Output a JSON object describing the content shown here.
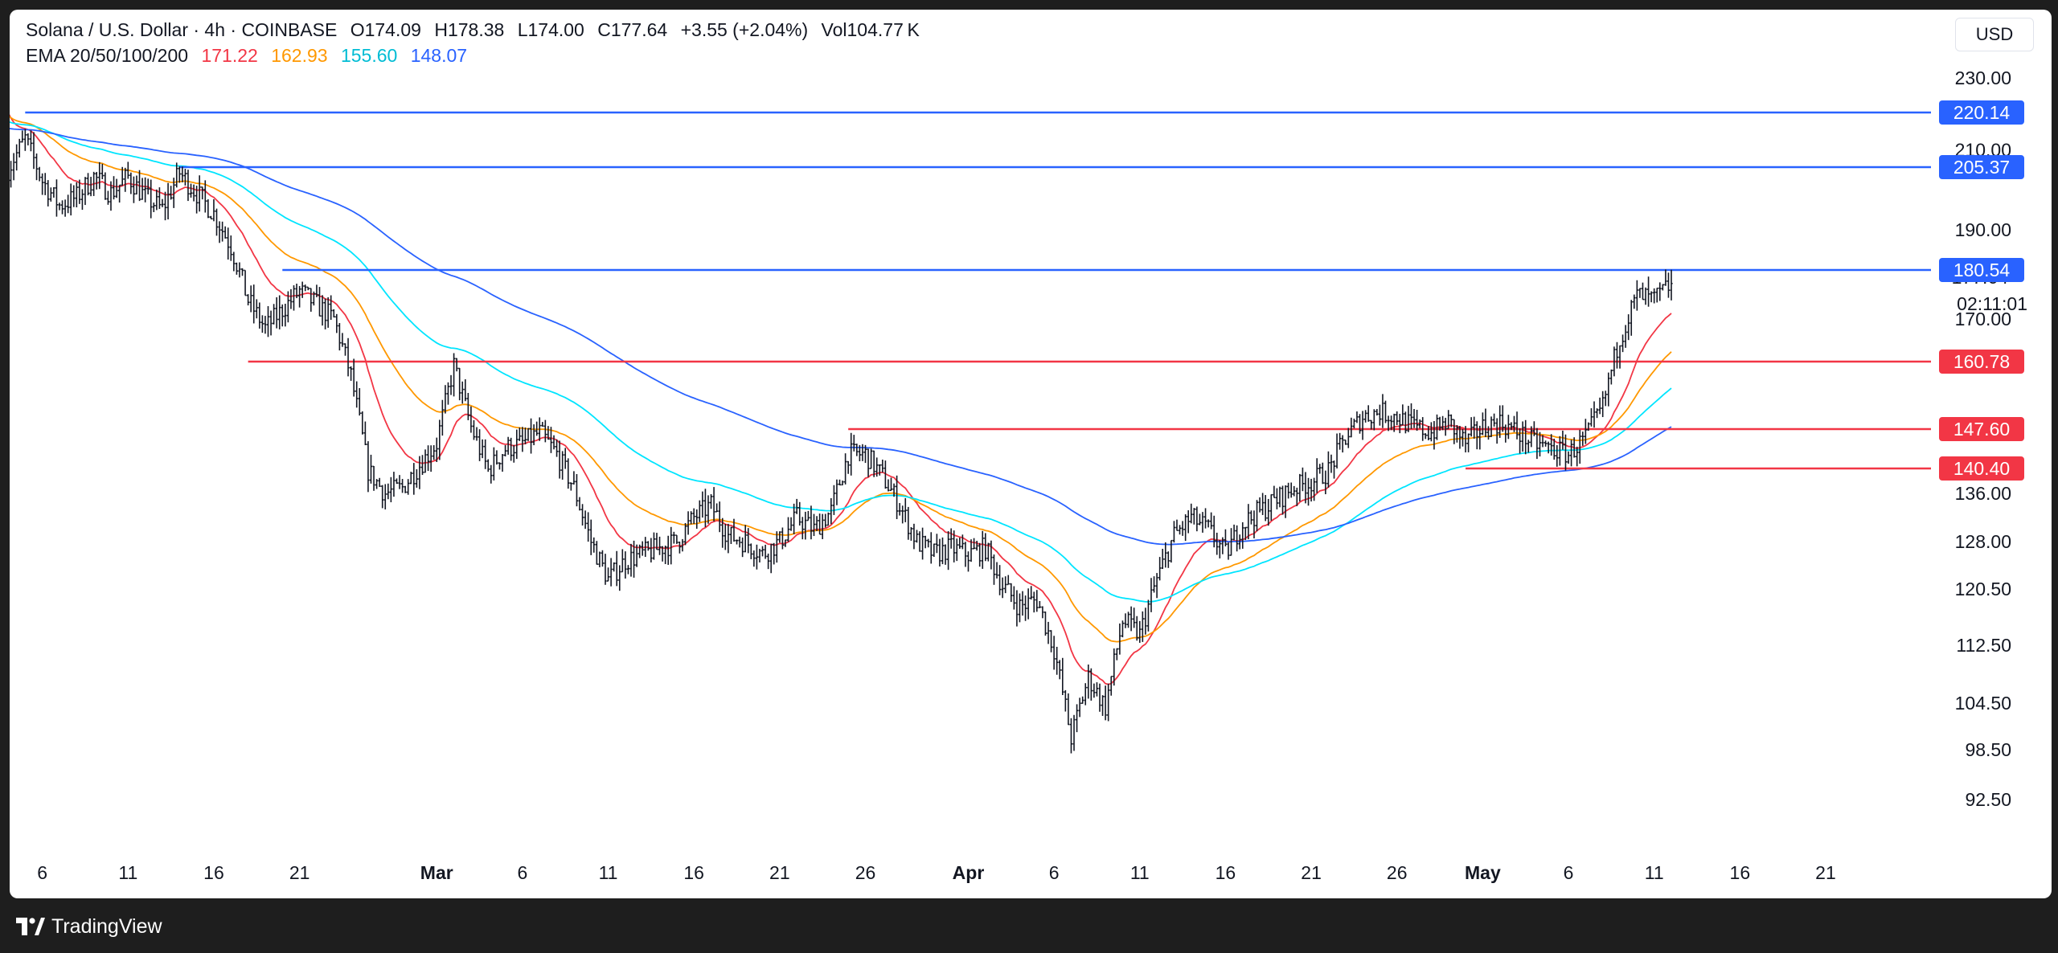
{
  "header": {
    "symbol": "Solana / U.S. Dollar · 4h · COINBASE",
    "open": "O174.09",
    "high": "H178.38",
    "low": "L174.00",
    "close": "C177.64",
    "change": "+3.55 (+2.04%)",
    "volume": "Vol104.77 K",
    "ema_label": "EMA 20/50/100/200",
    "ema_values": [
      {
        "text": "171.22",
        "color": "#f23645"
      },
      {
        "text": "162.93",
        "color": "#ff9800"
      },
      {
        "text": "155.60",
        "color": "#00e5ff"
      },
      {
        "text": "148.07",
        "color": "#2962ff"
      }
    ]
  },
  "currency": "USD",
  "countdown": "02:11:01",
  "brand": "TradingView",
  "chart_data": {
    "type": "candlestick",
    "x_start": "2025-02-04",
    "bar_hours": 4,
    "x_ticks": [
      "6",
      "11",
      "16",
      "21",
      "Mar",
      "6",
      "11",
      "16",
      "21",
      "26",
      "Apr",
      "6",
      "11",
      "16",
      "21",
      "26",
      "May",
      "6",
      "11",
      "16",
      "21"
    ],
    "x_tick_dates": [
      "2025-02-06",
      "2025-02-11",
      "2025-02-16",
      "2025-02-21",
      "2025-03-01",
      "2025-03-06",
      "2025-03-11",
      "2025-03-16",
      "2025-03-21",
      "2025-03-26",
      "2025-04-01",
      "2025-04-06",
      "2025-04-11",
      "2025-04-16",
      "2025-04-21",
      "2025-04-26",
      "2025-05-01",
      "2025-05-06",
      "2025-05-11",
      "2025-05-16",
      "2025-05-21"
    ],
    "y_ticks": [
      {
        "label": "230.00",
        "value": 230
      },
      {
        "label": "210.00",
        "value": 210
      },
      {
        "label": "190.00",
        "value": 190
      },
      {
        "label": "170.00",
        "value": 170
      },
      {
        "label": "136.00",
        "value": 136
      },
      {
        "label": "128.00",
        "value": 128
      },
      {
        "label": "120.50",
        "value": 120.5
      },
      {
        "label": "112.50",
        "value": 112.5
      },
      {
        "label": "104.50",
        "value": 104.5
      },
      {
        "label": "98.50",
        "value": 98.5
      },
      {
        "label": "92.50",
        "value": 92.5
      }
    ],
    "ylim": [
      88,
      236
    ],
    "last_price": "177.64",
    "levels": [
      {
        "label": "220.14",
        "value": 220.14,
        "color": "#2962ff",
        "from": "2025-02-05"
      },
      {
        "label": "205.37",
        "value": 205.37,
        "color": "#2962ff",
        "from": "2025-02-14"
      },
      {
        "label": "180.54",
        "value": 180.54,
        "color": "#2962ff",
        "from": "2025-02-20"
      },
      {
        "label": "160.78",
        "value": 160.78,
        "color": "#f23645",
        "from": "2025-02-18"
      },
      {
        "label": "147.60",
        "value": 147.6,
        "color": "#f23645",
        "from": "2025-03-25"
      },
      {
        "label": "140.40",
        "value": 140.4,
        "color": "#f23645",
        "from": "2025-04-30"
      }
    ],
    "ema_colors": [
      "#f23645",
      "#ff9800",
      "#00e5ff",
      "#2962ff"
    ],
    "closes": [
      {
        "d": "2025-02-04",
        "c": 205
      },
      {
        "d": "2025-02-05",
        "c": 213
      },
      {
        "d": "2025-02-06",
        "c": 202
      },
      {
        "d": "2025-02-07",
        "c": 196
      },
      {
        "d": "2025-02-08",
        "c": 198
      },
      {
        "d": "2025-02-09",
        "c": 203
      },
      {
        "d": "2025-02-10",
        "c": 199
      },
      {
        "d": "2025-02-11",
        "c": 203
      },
      {
        "d": "2025-02-12",
        "c": 198
      },
      {
        "d": "2025-02-13",
        "c": 195
      },
      {
        "d": "2025-02-14",
        "c": 204
      },
      {
        "d": "2025-02-15",
        "c": 199
      },
      {
        "d": "2025-02-16",
        "c": 194
      },
      {
        "d": "2025-02-17",
        "c": 186
      },
      {
        "d": "2025-02-18",
        "c": 174
      },
      {
        "d": "2025-02-19",
        "c": 168
      },
      {
        "d": "2025-02-20",
        "c": 172
      },
      {
        "d": "2025-02-21",
        "c": 176
      },
      {
        "d": "2025-02-22",
        "c": 173
      },
      {
        "d": "2025-02-23",
        "c": 170
      },
      {
        "d": "2025-02-24",
        "c": 158
      },
      {
        "d": "2025-02-25",
        "c": 140
      },
      {
        "d": "2025-02-26",
        "c": 136
      },
      {
        "d": "2025-02-27",
        "c": 137
      },
      {
        "d": "2025-02-28",
        "c": 141
      },
      {
        "d": "2025-03-01",
        "c": 145
      },
      {
        "d": "2025-03-02",
        "c": 160
      },
      {
        "d": "2025-03-03",
        "c": 148
      },
      {
        "d": "2025-03-04",
        "c": 140
      },
      {
        "d": "2025-03-05",
        "c": 144
      },
      {
        "d": "2025-03-06",
        "c": 145
      },
      {
        "d": "2025-03-07",
        "c": 147
      },
      {
        "d": "2025-03-08",
        "c": 143
      },
      {
        "d": "2025-03-09",
        "c": 137
      },
      {
        "d": "2025-03-10",
        "c": 128
      },
      {
        "d": "2025-03-11",
        "c": 122
      },
      {
        "d": "2025-03-12",
        "c": 125
      },
      {
        "d": "2025-03-13",
        "c": 126
      },
      {
        "d": "2025-03-14",
        "c": 127
      },
      {
        "d": "2025-03-15",
        "c": 128
      },
      {
        "d": "2025-03-16",
        "c": 132
      },
      {
        "d": "2025-03-17",
        "c": 134
      },
      {
        "d": "2025-03-18",
        "c": 129
      },
      {
        "d": "2025-03-19",
        "c": 128
      },
      {
        "d": "2025-03-20",
        "c": 126
      },
      {
        "d": "2025-03-21",
        "c": 128
      },
      {
        "d": "2025-03-22",
        "c": 132
      },
      {
        "d": "2025-03-23",
        "c": 130
      },
      {
        "d": "2025-03-24",
        "c": 133
      },
      {
        "d": "2025-03-25",
        "c": 143
      },
      {
        "d": "2025-03-26",
        "c": 143
      },
      {
        "d": "2025-03-27",
        "c": 139
      },
      {
        "d": "2025-03-28",
        "c": 134
      },
      {
        "d": "2025-03-29",
        "c": 128
      },
      {
        "d": "2025-03-30",
        "c": 126
      },
      {
        "d": "2025-03-31",
        "c": 127
      },
      {
        "d": "2025-04-01",
        "c": 126
      },
      {
        "d": "2025-04-02",
        "c": 127
      },
      {
        "d": "2025-04-03",
        "c": 121
      },
      {
        "d": "2025-04-04",
        "c": 118
      },
      {
        "d": "2025-04-05",
        "c": 119
      },
      {
        "d": "2025-04-06",
        "c": 112
      },
      {
        "d": "2025-04-07",
        "c": 100
      },
      {
        "d": "2025-04-08",
        "c": 108
      },
      {
        "d": "2025-04-09",
        "c": 104
      },
      {
        "d": "2025-04-10",
        "c": 116
      },
      {
        "d": "2025-04-11",
        "c": 114
      },
      {
        "d": "2025-04-12",
        "c": 122
      },
      {
        "d": "2025-04-13",
        "c": 129
      },
      {
        "d": "2025-04-14",
        "c": 132
      },
      {
        "d": "2025-04-15",
        "c": 130
      },
      {
        "d": "2025-04-16",
        "c": 126
      },
      {
        "d": "2025-04-17",
        "c": 131
      },
      {
        "d": "2025-04-18",
        "c": 133
      },
      {
        "d": "2025-04-19",
        "c": 135
      },
      {
        "d": "2025-04-20",
        "c": 137
      },
      {
        "d": "2025-04-21",
        "c": 138
      },
      {
        "d": "2025-04-22",
        "c": 140
      },
      {
        "d": "2025-04-23",
        "c": 146
      },
      {
        "d": "2025-04-24",
        "c": 150
      },
      {
        "d": "2025-04-25",
        "c": 151
      },
      {
        "d": "2025-04-26",
        "c": 150
      },
      {
        "d": "2025-04-27",
        "c": 148
      },
      {
        "d": "2025-04-28",
        "c": 147
      },
      {
        "d": "2025-04-29",
        "c": 149
      },
      {
        "d": "2025-04-30",
        "c": 145
      },
      {
        "d": "2025-05-01",
        "c": 148
      },
      {
        "d": "2025-05-02",
        "c": 149
      },
      {
        "d": "2025-05-03",
        "c": 147
      },
      {
        "d": "2025-05-04",
        "c": 145
      },
      {
        "d": "2025-05-05",
        "c": 144
      },
      {
        "d": "2025-05-06",
        "c": 143
      },
      {
        "d": "2025-05-07",
        "c": 146
      },
      {
        "d": "2025-05-08",
        "c": 152
      },
      {
        "d": "2025-05-09",
        "c": 166
      },
      {
        "d": "2025-05-10",
        "c": 175
      },
      {
        "d": "2025-05-11",
        "c": 174
      },
      {
        "d": "2025-05-12",
        "c": 177.64
      }
    ],
    "ema_endpoints": [
      171.22,
      162.93,
      155.6,
      148.07
    ]
  }
}
